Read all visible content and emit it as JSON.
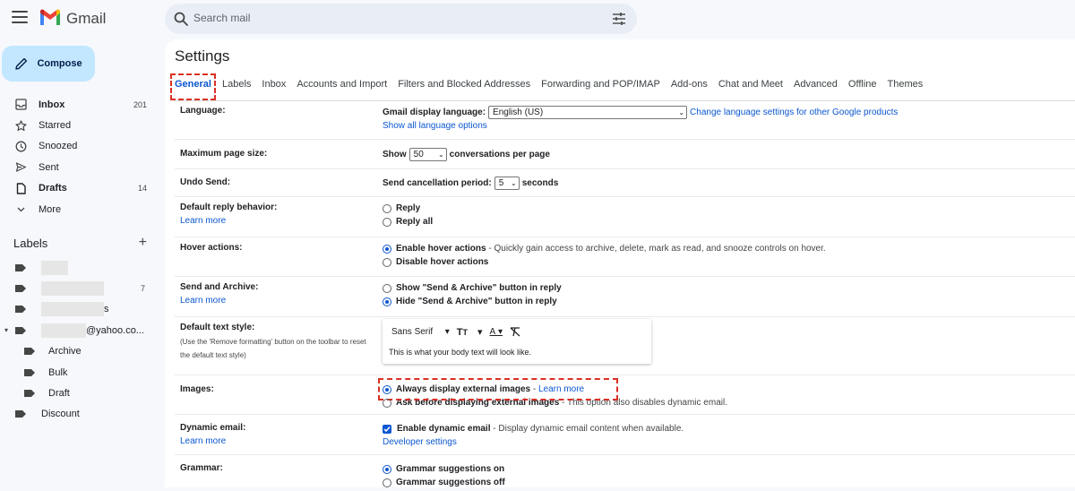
{
  "app": {
    "brand": "Gmail",
    "search_placeholder": "Search mail"
  },
  "sidebar": {
    "compose_label": "Compose",
    "items": [
      {
        "label": "Inbox",
        "count": "201",
        "icon": "inbox-icon",
        "bold": true
      },
      {
        "label": "Starred",
        "count": "",
        "icon": "star-icon",
        "bold": false
      },
      {
        "label": "Snoozed",
        "count": "",
        "icon": "clock-icon",
        "bold": false
      },
      {
        "label": "Sent",
        "count": "",
        "icon": "send-icon",
        "bold": false
      },
      {
        "label": "Drafts",
        "count": "14",
        "icon": "draft-icon",
        "bold": true
      },
      {
        "label": "More",
        "count": "",
        "icon": "chevron-down-icon",
        "bold": false
      }
    ],
    "labels_heading": "Labels",
    "labels": [
      {
        "label": "",
        "count": ""
      },
      {
        "label": "",
        "count": "7"
      },
      {
        "label": "s",
        "count": ""
      },
      {
        "label": "@yahoo.co...",
        "count": ""
      },
      {
        "label": "Archive",
        "count": ""
      },
      {
        "label": "Bulk",
        "count": ""
      },
      {
        "label": "Draft",
        "count": ""
      },
      {
        "label": "Discount",
        "count": ""
      }
    ]
  },
  "settings": {
    "title": "Settings",
    "tabs": [
      "General",
      "Labels",
      "Inbox",
      "Accounts and Import",
      "Filters and Blocked Addresses",
      "Forwarding and POP/IMAP",
      "Add-ons",
      "Chat and Meet",
      "Advanced",
      "Offline",
      "Themes"
    ],
    "active_tab": "General",
    "language": {
      "label": "Language:",
      "display_label": "Gmail display language:",
      "value": "English (US)",
      "change_link": "Change language settings for other Google products",
      "show_all": "Show all language options"
    },
    "page_size": {
      "label": "Maximum page size:",
      "prefix": "Show",
      "value": "50",
      "suffix": "conversations per page"
    },
    "undo_send": {
      "label": "Undo Send:",
      "prefix": "Send cancellation period:",
      "value": "5",
      "suffix": "seconds"
    },
    "reply": {
      "label": "Default reply behavior:",
      "learn_more": "Learn more",
      "opt1": "Reply",
      "opt2": "Reply all"
    },
    "hover": {
      "label": "Hover actions:",
      "opt1": "Enable hover actions",
      "opt1_desc": "- Quickly gain access to archive, delete, mark as read, and snooze controls on hover.",
      "opt2": "Disable hover actions"
    },
    "send_archive": {
      "label": "Send and Archive:",
      "learn_more": "Learn more",
      "opt1": "Show \"Send & Archive\" button in reply",
      "opt2": "Hide \"Send & Archive\" button in reply"
    },
    "text_style": {
      "label": "Default text style:",
      "note": "(Use the 'Remove formatting' button on the toolbar to reset the default text style)",
      "font": "Sans Serif",
      "sample": "This is what your body text will look like."
    },
    "images": {
      "label": "Images:",
      "opt1": "Always display external images",
      "opt1_sep": "-",
      "opt1_link": "Learn more",
      "opt2": "Ask before displaying external images",
      "opt2_desc": "- This option also disables dynamic email."
    },
    "dynamic": {
      "label": "Dynamic email:",
      "learn_more": "Learn more",
      "opt1": "Enable dynamic email",
      "opt1_desc": "- Display dynamic email content when available.",
      "dev_settings": "Developer settings"
    },
    "grammar": {
      "label": "Grammar:",
      "opt1": "Grammar suggestions on",
      "opt2": "Grammar suggestions off"
    }
  },
  "colors": {
    "accent": "#0b57d0",
    "compose_bg": "#c2e7ff",
    "highlight": "#d93025"
  }
}
